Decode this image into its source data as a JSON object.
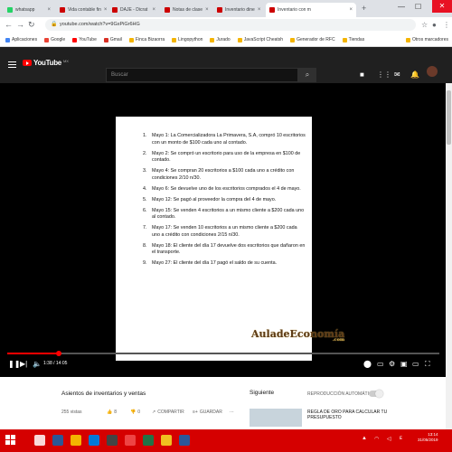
{
  "browser": {
    "tabs": [
      {
        "label": "whatsapp",
        "active": false
      },
      {
        "label": "Vida contable fin",
        "active": false
      },
      {
        "label": "DAJE - Dicrat",
        "active": false
      },
      {
        "label": "Notas de clase",
        "active": false
      },
      {
        "label": "Inventario dine",
        "active": false
      },
      {
        "label": "Inventario con m",
        "active": true
      }
    ],
    "url": "youtube.com/watch?v=9GxPiGr6HG",
    "bookmarks": [
      "Aplicaciones",
      "Google",
      "YouTube",
      "Gmail",
      "Finca Bizaorra",
      "Lingopython",
      "Jurado",
      "JavaScript Cheatsh",
      "Generador de RFC",
      "Tiendas",
      "Otros marcadores"
    ]
  },
  "youtube": {
    "search_placeholder": "Buscar",
    "logo_text": "YouTube",
    "logo_country": "MX"
  },
  "document": {
    "items": [
      {
        "num": "1.",
        "text": "Mayo 1: La Comercializadora La Primavera, S.A, compró 10 escritorios con un monto de $100 cada uno al contado."
      },
      {
        "num": "2.",
        "text": "Mayo 2: Se compró un escritorio para uso de la empresa en $100 de contado."
      },
      {
        "num": "3.",
        "text": "Mayo 4: Se compran 20 escritorios a $100 cada uno a crédito con condiciones 2/10 n/30."
      },
      {
        "num": "4.",
        "text": "Mayo 6: Se devuelve uno de los escritorios comprados el 4 de mayo."
      },
      {
        "num": "5.",
        "text": "Mayo 12: Se pagó al proveedor la compra del 4 de mayo."
      },
      {
        "num": "6.",
        "text": "Mayo 15: Se venden 4 escritorios a un mismo cliente a $200 cada uno al contado."
      },
      {
        "num": "7.",
        "text": "Mayo 17: Se venden 10 escritorios a un mismo cliente a $200 cada uno a crédito con condiciones 2/15 n/30."
      },
      {
        "num": "8.",
        "text": "Mayo 18: El cliente del día 17 devuelve dos escritorios que dañaron en el transporte."
      },
      {
        "num": "9.",
        "text": "Mayo 27: El cliente del día 17 pagó el saldo de su cuenta."
      }
    ],
    "watermark": "AuladeEconomía",
    "watermark_suffix": ".com"
  },
  "player": {
    "progress": 0.12,
    "time": "1:38 / 14:05"
  },
  "video_info": {
    "title": "Asientos de inventarios y ventas",
    "views": "255 vistas",
    "likes": "8",
    "dislikes": "0",
    "share": "COMPARTIR",
    "save": "GUARDAR",
    "next_label": "Siguiente",
    "autoplay_label": "REPRODUCCIÓN AUTOMÁTICA",
    "rec_title": "REGLA DE ORO PARA CALCULAR TU PRESUPUESTO"
  },
  "taskbar": {
    "time": "13:14",
    "date": "31/05/2019"
  }
}
